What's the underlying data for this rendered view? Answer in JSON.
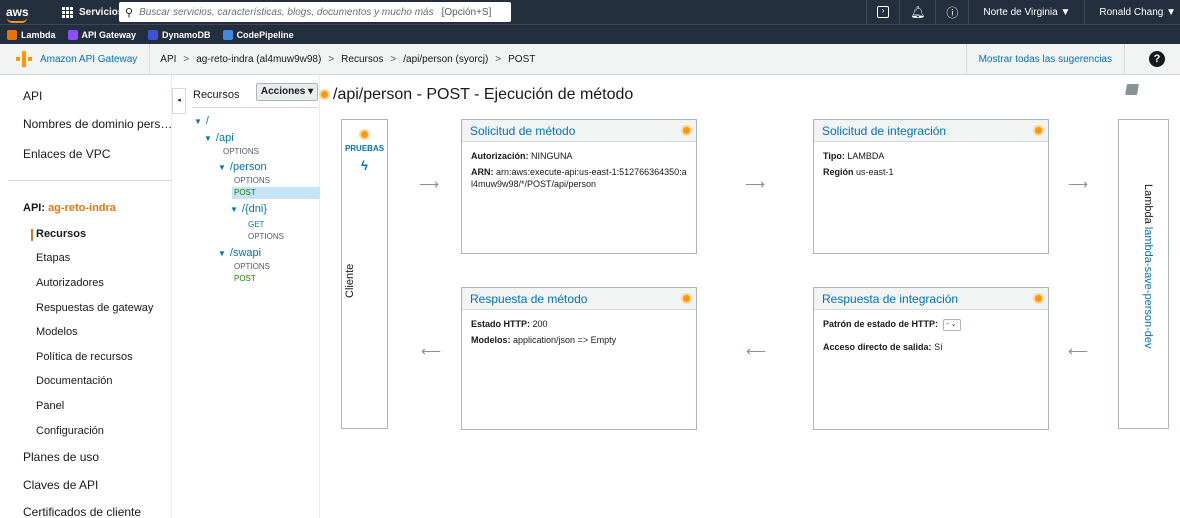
{
  "topnav": {
    "logo": "aws",
    "services_label": "Servicios",
    "search_placeholder": "Buscar servicios, características, blogs, documentos y mucho más",
    "search_shortcut": "[Opción+S]",
    "region": "Norte de Virginia ▼",
    "user": "Ronald Chang ▼",
    "terminal_icon": "cloudshell-icon",
    "bell_icon": "bell-icon",
    "help_icon": "help-circle-icon"
  },
  "favorites": [
    {
      "label": "Lambda",
      "color": "#ed7100"
    },
    {
      "label": "API Gateway",
      "color": "#8c4fff"
    },
    {
      "label": "DynamoDB",
      "color": "#4053d6"
    },
    {
      "label": "CodePipeline",
      "color": "#3f8ae0"
    }
  ],
  "breadcrumb": {
    "service": "Amazon API Gateway",
    "items": [
      "API",
      "ag-reto-indra (al4muw9w98)",
      "Recursos",
      "/api/person (syorcj)",
      "POST"
    ],
    "separator": ">",
    "suggestions": "Mostrar todas las sugerencias",
    "help": "?"
  },
  "sidebar": {
    "api": "API",
    "custom_domains": "Nombres de dominio pers…",
    "vpc_links": "Enlaces de VPC",
    "api_prefix": "API:",
    "api_name": "ag-reto-indra",
    "resources": "Recursos",
    "stages": "Etapas",
    "authorizers": "Autorizadores",
    "gateway_responses": "Respuestas de gateway",
    "models": "Modelos",
    "resource_policy": "Política de recursos",
    "documentation": "Documentación",
    "dashboard": "Panel",
    "settings": "Configuración",
    "usage_plans": "Planes de uso",
    "api_keys": "Claves de API",
    "client_certs": "Certificados de cliente",
    "collapse": "◂"
  },
  "tree": {
    "header": "Recursos",
    "actions": "Acciones ▾",
    "root": "/",
    "api": "/api",
    "api_options": "OPTIONS",
    "person": "/person",
    "person_options": "OPTIONS",
    "person_post": "POST",
    "dni": "/{dni}",
    "dni_get": "GET",
    "dni_options": "OPTIONS",
    "swapi": "/swapi",
    "swapi_options": "OPTIONS",
    "swapi_post": "POST",
    "arrow": "▼"
  },
  "main": {
    "title": "/api/person - POST - Ejecución de método",
    "client": {
      "pruebas": "PRUEBAS",
      "bolt": "ϟ",
      "label": "Cliente"
    },
    "method_request": {
      "title": "Solicitud de método",
      "auth_label": "Autorización:",
      "auth_value": "NINGUNA",
      "arn_label": "ARN:",
      "arn_value": "arn:aws:execute-api:us-east-1:512766364350:al4muw9w98/*/POST/api/person"
    },
    "integration_request": {
      "title": "Solicitud de integración",
      "type_label": "Tipo:",
      "type_value": "LAMBDA",
      "region_label": "Región",
      "region_value": "us-east-1"
    },
    "method_response": {
      "title": "Respuesta de método",
      "status_label": "Estado HTTP:",
      "status_value": "200",
      "models_label": "Modelos:",
      "models_value": "application/json => Empty"
    },
    "integration_response": {
      "title": "Respuesta de integración",
      "pattern_label": "Patrón de estado de HTTP:",
      "pattern_value": "- ⌄",
      "passthrough_label": "Acceso directo de salida:",
      "passthrough_value": "Sí"
    },
    "lambda": {
      "prefix": "Lambda",
      "function": "lambda-save-person-dev"
    },
    "arrow_right": "⟶",
    "arrow_left": "⟵"
  },
  "colors": {
    "accent": "#ec7211",
    "link": "#0073bb",
    "nav": "#232f3e",
    "gear": "#ff9900"
  }
}
